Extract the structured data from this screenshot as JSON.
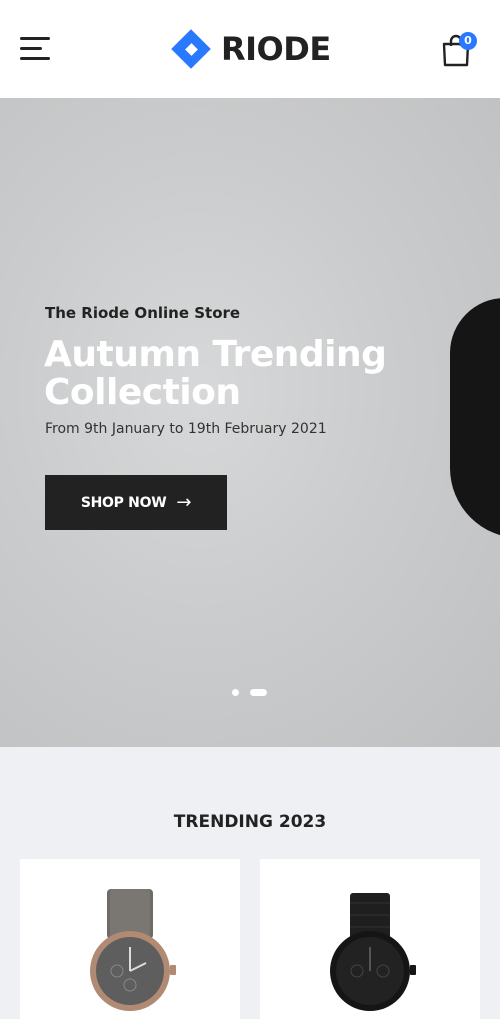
{
  "header": {
    "logo_text": "RIODE",
    "cart_count": "0",
    "icons": {
      "menu": "hamburger-menu-icon",
      "cart": "shopping-bag-icon",
      "logo": "diamond-logo-icon"
    }
  },
  "hero": {
    "subtitle": "The Riode Online Store",
    "title_line1": "Autumn Trending",
    "title_line2": "Collection",
    "dates": "From 9th January to 19th February 2021",
    "button_label": "SHOP NOW",
    "button_arrow": "→",
    "slides": {
      "count": 2,
      "active": 2
    }
  },
  "trending": {
    "title": "TRENDING 2023",
    "products": [
      {
        "image": "grey-dial-watch-leather-strap"
      },
      {
        "image": "black-chronograph-watch-metal-band"
      }
    ]
  },
  "colors": {
    "accent": "#2879fe",
    "dark": "#222222",
    "hero_bg": "#cbcccd"
  }
}
